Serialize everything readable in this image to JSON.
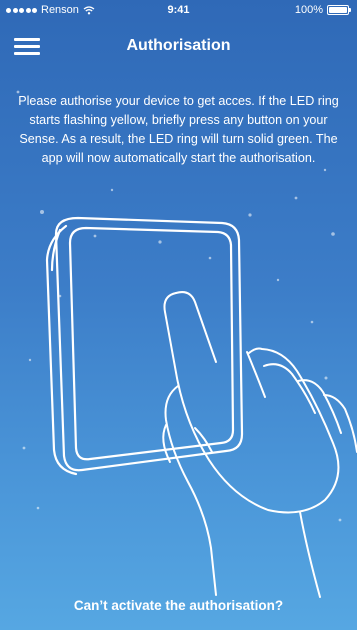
{
  "status_bar": {
    "carrier": "Renson",
    "time": "9:41",
    "battery_percent": "100%",
    "icons": [
      "signal-dots-icon",
      "wifi-icon",
      "battery-icon"
    ]
  },
  "nav": {
    "title": "Authorisation",
    "menu_icon": "hamburger-menu-icon"
  },
  "instructions": "Please authorise your device to get acces. If the LED ring starts flashing yellow, briefly press any button on your Sense. As a result, the LED ring will turn solid green. The app will now automatically start the authorisation.",
  "illustration": {
    "icon": "hand-pressing-sense-device-illustration"
  },
  "help_link": "Can’t activate the authorisation?",
  "colors": {
    "background_top": "#2f69b7",
    "background_bottom": "#56a7e2",
    "text": "#ffffff"
  }
}
